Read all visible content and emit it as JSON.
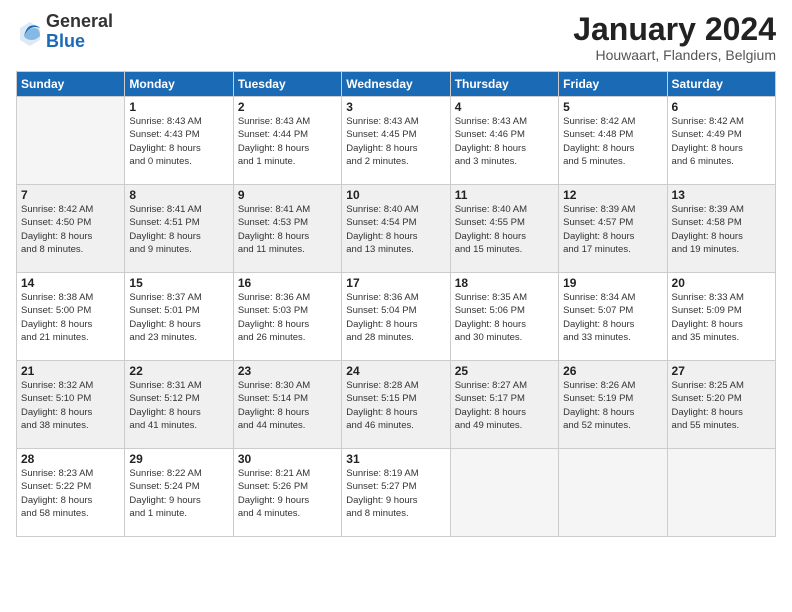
{
  "logo": {
    "general": "General",
    "blue": "Blue"
  },
  "header": {
    "month": "January 2024",
    "location": "Houwaart, Flanders, Belgium"
  },
  "days_of_week": [
    "Sunday",
    "Monday",
    "Tuesday",
    "Wednesday",
    "Thursday",
    "Friday",
    "Saturday"
  ],
  "weeks": [
    {
      "shaded": false,
      "days": [
        {
          "date": "",
          "info": ""
        },
        {
          "date": "1",
          "info": "Sunrise: 8:43 AM\nSunset: 4:43 PM\nDaylight: 8 hours\nand 0 minutes."
        },
        {
          "date": "2",
          "info": "Sunrise: 8:43 AM\nSunset: 4:44 PM\nDaylight: 8 hours\nand 1 minute."
        },
        {
          "date": "3",
          "info": "Sunrise: 8:43 AM\nSunset: 4:45 PM\nDaylight: 8 hours\nand 2 minutes."
        },
        {
          "date": "4",
          "info": "Sunrise: 8:43 AM\nSunset: 4:46 PM\nDaylight: 8 hours\nand 3 minutes."
        },
        {
          "date": "5",
          "info": "Sunrise: 8:42 AM\nSunset: 4:48 PM\nDaylight: 8 hours\nand 5 minutes."
        },
        {
          "date": "6",
          "info": "Sunrise: 8:42 AM\nSunset: 4:49 PM\nDaylight: 8 hours\nand 6 minutes."
        }
      ]
    },
    {
      "shaded": true,
      "days": [
        {
          "date": "7",
          "info": "Sunrise: 8:42 AM\nSunset: 4:50 PM\nDaylight: 8 hours\nand 8 minutes."
        },
        {
          "date": "8",
          "info": "Sunrise: 8:41 AM\nSunset: 4:51 PM\nDaylight: 8 hours\nand 9 minutes."
        },
        {
          "date": "9",
          "info": "Sunrise: 8:41 AM\nSunset: 4:53 PM\nDaylight: 8 hours\nand 11 minutes."
        },
        {
          "date": "10",
          "info": "Sunrise: 8:40 AM\nSunset: 4:54 PM\nDaylight: 8 hours\nand 13 minutes."
        },
        {
          "date": "11",
          "info": "Sunrise: 8:40 AM\nSunset: 4:55 PM\nDaylight: 8 hours\nand 15 minutes."
        },
        {
          "date": "12",
          "info": "Sunrise: 8:39 AM\nSunset: 4:57 PM\nDaylight: 8 hours\nand 17 minutes."
        },
        {
          "date": "13",
          "info": "Sunrise: 8:39 AM\nSunset: 4:58 PM\nDaylight: 8 hours\nand 19 minutes."
        }
      ]
    },
    {
      "shaded": false,
      "days": [
        {
          "date": "14",
          "info": "Sunrise: 8:38 AM\nSunset: 5:00 PM\nDaylight: 8 hours\nand 21 minutes."
        },
        {
          "date": "15",
          "info": "Sunrise: 8:37 AM\nSunset: 5:01 PM\nDaylight: 8 hours\nand 23 minutes."
        },
        {
          "date": "16",
          "info": "Sunrise: 8:36 AM\nSunset: 5:03 PM\nDaylight: 8 hours\nand 26 minutes."
        },
        {
          "date": "17",
          "info": "Sunrise: 8:36 AM\nSunset: 5:04 PM\nDaylight: 8 hours\nand 28 minutes."
        },
        {
          "date": "18",
          "info": "Sunrise: 8:35 AM\nSunset: 5:06 PM\nDaylight: 8 hours\nand 30 minutes."
        },
        {
          "date": "19",
          "info": "Sunrise: 8:34 AM\nSunset: 5:07 PM\nDaylight: 8 hours\nand 33 minutes."
        },
        {
          "date": "20",
          "info": "Sunrise: 8:33 AM\nSunset: 5:09 PM\nDaylight: 8 hours\nand 35 minutes."
        }
      ]
    },
    {
      "shaded": true,
      "days": [
        {
          "date": "21",
          "info": "Sunrise: 8:32 AM\nSunset: 5:10 PM\nDaylight: 8 hours\nand 38 minutes."
        },
        {
          "date": "22",
          "info": "Sunrise: 8:31 AM\nSunset: 5:12 PM\nDaylight: 8 hours\nand 41 minutes."
        },
        {
          "date": "23",
          "info": "Sunrise: 8:30 AM\nSunset: 5:14 PM\nDaylight: 8 hours\nand 44 minutes."
        },
        {
          "date": "24",
          "info": "Sunrise: 8:28 AM\nSunset: 5:15 PM\nDaylight: 8 hours\nand 46 minutes."
        },
        {
          "date": "25",
          "info": "Sunrise: 8:27 AM\nSunset: 5:17 PM\nDaylight: 8 hours\nand 49 minutes."
        },
        {
          "date": "26",
          "info": "Sunrise: 8:26 AM\nSunset: 5:19 PM\nDaylight: 8 hours\nand 52 minutes."
        },
        {
          "date": "27",
          "info": "Sunrise: 8:25 AM\nSunset: 5:20 PM\nDaylight: 8 hours\nand 55 minutes."
        }
      ]
    },
    {
      "shaded": false,
      "days": [
        {
          "date": "28",
          "info": "Sunrise: 8:23 AM\nSunset: 5:22 PM\nDaylight: 8 hours\nand 58 minutes."
        },
        {
          "date": "29",
          "info": "Sunrise: 8:22 AM\nSunset: 5:24 PM\nDaylight: 9 hours\nand 1 minute."
        },
        {
          "date": "30",
          "info": "Sunrise: 8:21 AM\nSunset: 5:26 PM\nDaylight: 9 hours\nand 4 minutes."
        },
        {
          "date": "31",
          "info": "Sunrise: 8:19 AM\nSunset: 5:27 PM\nDaylight: 9 hours\nand 8 minutes."
        },
        {
          "date": "",
          "info": ""
        },
        {
          "date": "",
          "info": ""
        },
        {
          "date": "",
          "info": ""
        }
      ]
    }
  ]
}
